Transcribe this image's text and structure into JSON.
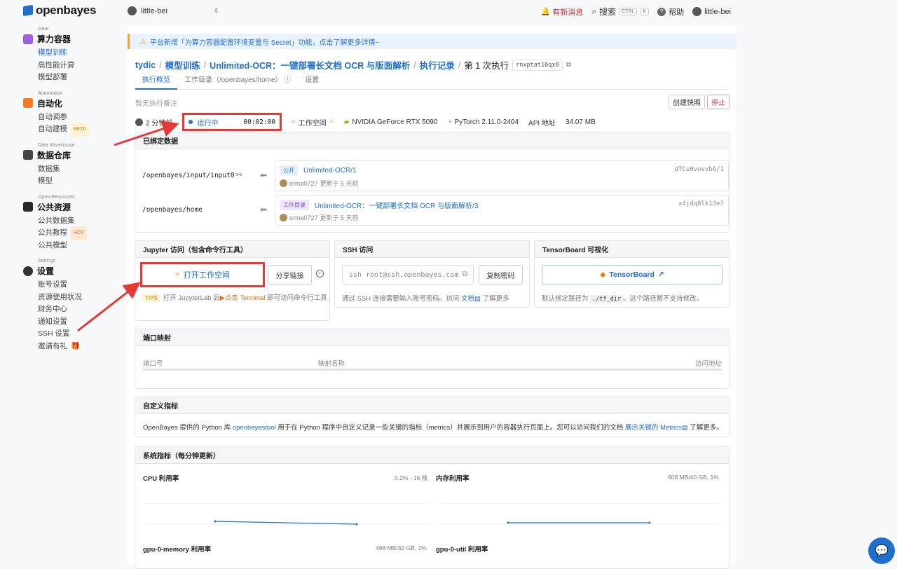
{
  "app": {
    "logo": "openbayes",
    "user": "little-bei"
  },
  "topbar": {
    "notif": "有新消息",
    "search": "搜索",
    "kbd1": "CTRL",
    "kbd2": "K",
    "help": "帮助",
    "account": "little-bei"
  },
  "sidebar": [
    {
      "cap": "Gear",
      "title": "算力容器",
      "items": [
        "模型训练",
        "高性能计算",
        "模型部署"
      ],
      "active": 0
    },
    {
      "cap": "Automation",
      "title": "自动化",
      "items": [
        "自动调参",
        "自动建模"
      ],
      "badges": {
        "1": "BETA"
      }
    },
    {
      "cap": "Data Warehouse",
      "title": "数据仓库",
      "items": [
        "数据集",
        "模型"
      ]
    },
    {
      "cap": "Open Resources",
      "title": "公共资源",
      "items": [
        "公共数据集",
        "公共教程",
        "公共模型"
      ],
      "badges": {
        "1": "HOT"
      }
    },
    {
      "cap": "Settings",
      "title": "设置",
      "items": [
        "账号设置",
        "资源使用状况",
        "财务中心",
        "通知设置",
        "SSH 设置",
        "邀请有礼"
      ]
    }
  ],
  "banner": {
    "text": "平台新增「为算力容器配置环境变量与 Secret」功能，点击了解更多详情~"
  },
  "breadcrumb": {
    "user": "tydic",
    "section": "模型训练",
    "job": "Unlimited-OCR：一键部署长文档 OCR 与版面解析",
    "records": "执行记录",
    "current": "第 1 次执行",
    "run_id": "rnxptat16qx8"
  },
  "tabs": [
    "执行概览",
    "工作目录（/openbayes/home）",
    "设置"
  ],
  "note": "暂无执行备注",
  "actions": {
    "snapshot": "创建快照",
    "stop": "停止"
  },
  "status": {
    "ago": "2 分钟前",
    "state": "运行中",
    "timer": "00:02:00",
    "workspace": "工作空间",
    "gpu": "NVIDIA GeForce RTX 5090",
    "framework": "PyTorch 2.11.0-2404",
    "api": "API 地址",
    "size": "34.07 MB"
  },
  "bound": {
    "title": "已绑定数据",
    "rows": [
      {
        "path": "/openbayes/input/input0",
        "badge": "公开",
        "name": "Unlimited-OCR/1",
        "author": "erma0727",
        "updated": "更新于 5 天前",
        "hash": "dTCu0vovvb6/1"
      },
      {
        "path": "/openbayes/home",
        "badge": "工作目录",
        "name": "Unlimited-OCR：一键部署长文档 OCR 与版面解析/3",
        "author": "erma0727",
        "updated": "更新于 5 天前",
        "hash": "x4jdq8lk13e7"
      }
    ]
  },
  "jupyter": {
    "title": "Jupyter 访问（包含命令行工具）",
    "open": "打开工作空间",
    "share": "分享链接",
    "tips_badge": "TIPS",
    "tips_pre": "打开 JupyterLab 后",
    "tips_link": "点击 Terminal",
    "tips_post": "即可访问命令行工具"
  },
  "ssh": {
    "title": "SSH 访问",
    "cmd": "ssh root@ssh.openbayes.com",
    "copy": "复制密码",
    "note_pre": "通过 SSH 连接需要输入账号密码。访问",
    "note_link": "文档",
    "note_post": "了解更多"
  },
  "tensorboard": {
    "title": "TensorBoard 可视化",
    "button": "TensorBoard",
    "note_pre": "默认绑定路径为",
    "path": "./tf_dir",
    "note_post": "。这个路径暂不支持修改。"
  },
  "ports": {
    "title": "端口映射",
    "cols": [
      "端口号",
      "映射名称",
      "访问地址"
    ]
  },
  "metrics": {
    "title": "自定义指标",
    "pre": "OpenBayes 提供的 Python 库",
    "lib": "openbayestool",
    "mid": "用于在 Python 程序中自定义记录一些关键的指标（metrics）并展示到用户的容器执行页面上。您可以访问我们的文档",
    "link": "展示关键的 Metrics",
    "post": "了解更多。"
  },
  "system": {
    "title": "系统指标（每分钟更新）",
    "cpu": "CPU 利用率",
    "cpu_val": "0.2% - 16 核",
    "mem": "内存利用率",
    "mem_val": "608 MB/40 GB, 1%",
    "gpumem": "gpu-0-memory 利用率",
    "gpumem_val": "498 MB/32 GB, 1%",
    "gpuutil": "gpu-0-util 利用率"
  },
  "colors": {
    "accent": "#1f6fd1",
    "danger": "#e53935",
    "warn": "#f5a623"
  }
}
